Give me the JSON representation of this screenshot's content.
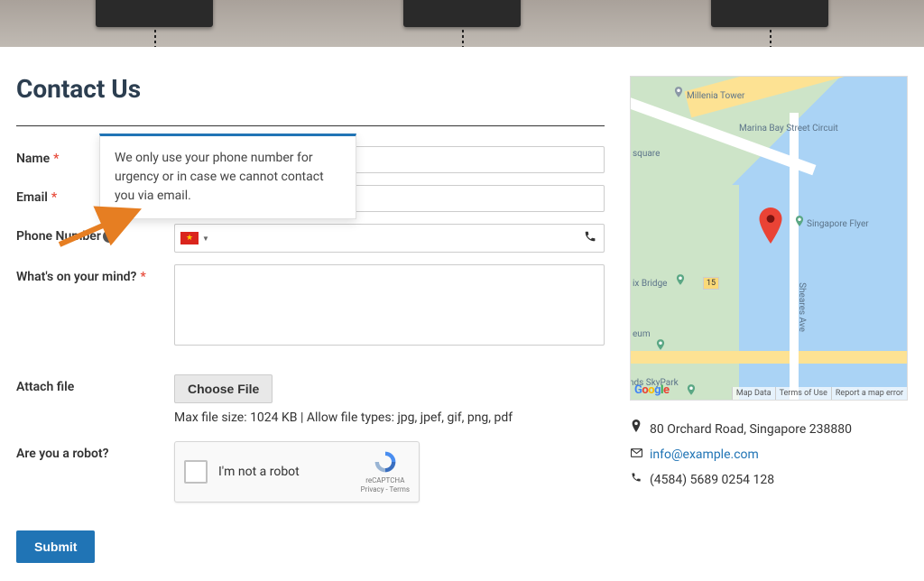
{
  "page": {
    "title": "Contact Us"
  },
  "form": {
    "name": {
      "label": "Name"
    },
    "email": {
      "label": "Email"
    },
    "phone": {
      "label": "Phone Number",
      "tooltip": "We only use your phone number for urgency or in case we cannot contact you via email."
    },
    "message": {
      "label": "What's on your mind?"
    },
    "file": {
      "label": "Attach file",
      "button": "Choose File",
      "hint": "Max file size: 1024 KB | Allow file types: jpg, jpef, gif, png, pdf"
    },
    "robot": {
      "label": "Are you a robot?",
      "recaptcha_text": "I'm not a robot",
      "recaptcha_brand": "reCAPTCHA",
      "recaptcha_links": "Privacy - Terms"
    },
    "submit": "Submit"
  },
  "map": {
    "labels": {
      "millenia": "Millenia Tower",
      "circuit": "Marina Bay Street Circuit",
      "square": "square",
      "flyer": "Singapore Flyer",
      "bridge": "ix Bridge",
      "museum": "eum",
      "skypark": "nds SkyPark",
      "sheares": "Sheares Ave",
      "route": "15"
    },
    "footer": {
      "mapdata": "Map Data",
      "terms": "Terms of Use",
      "report": "Report a map error"
    },
    "google": "Google"
  },
  "contact": {
    "address": "80 Orchard Road, Singapore 238880",
    "email": "info@example.com",
    "phone": "(4584) 5689 0254 128"
  }
}
